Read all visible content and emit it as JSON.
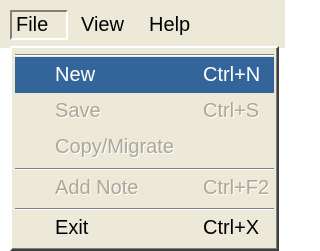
{
  "menubar": {
    "items": [
      {
        "label": "File"
      },
      {
        "label": "View"
      },
      {
        "label": "Help"
      }
    ]
  },
  "file_menu": {
    "items": [
      {
        "label": "New",
        "shortcut": "Ctrl+N",
        "state": "highlighted"
      },
      {
        "label": "Save",
        "shortcut": "Ctrl+S",
        "state": "disabled"
      },
      {
        "label": "Copy/Migrate",
        "shortcut": "",
        "state": "disabled"
      },
      {
        "label": "Add Note",
        "shortcut": "Ctrl+F2",
        "state": "disabled"
      },
      {
        "label": "Exit",
        "shortcut": "Ctrl+X",
        "state": "enabled"
      }
    ]
  },
  "colors": {
    "menu_background": "#ece9d8",
    "highlight": "#33659a",
    "disabled_text": "#aca899"
  }
}
